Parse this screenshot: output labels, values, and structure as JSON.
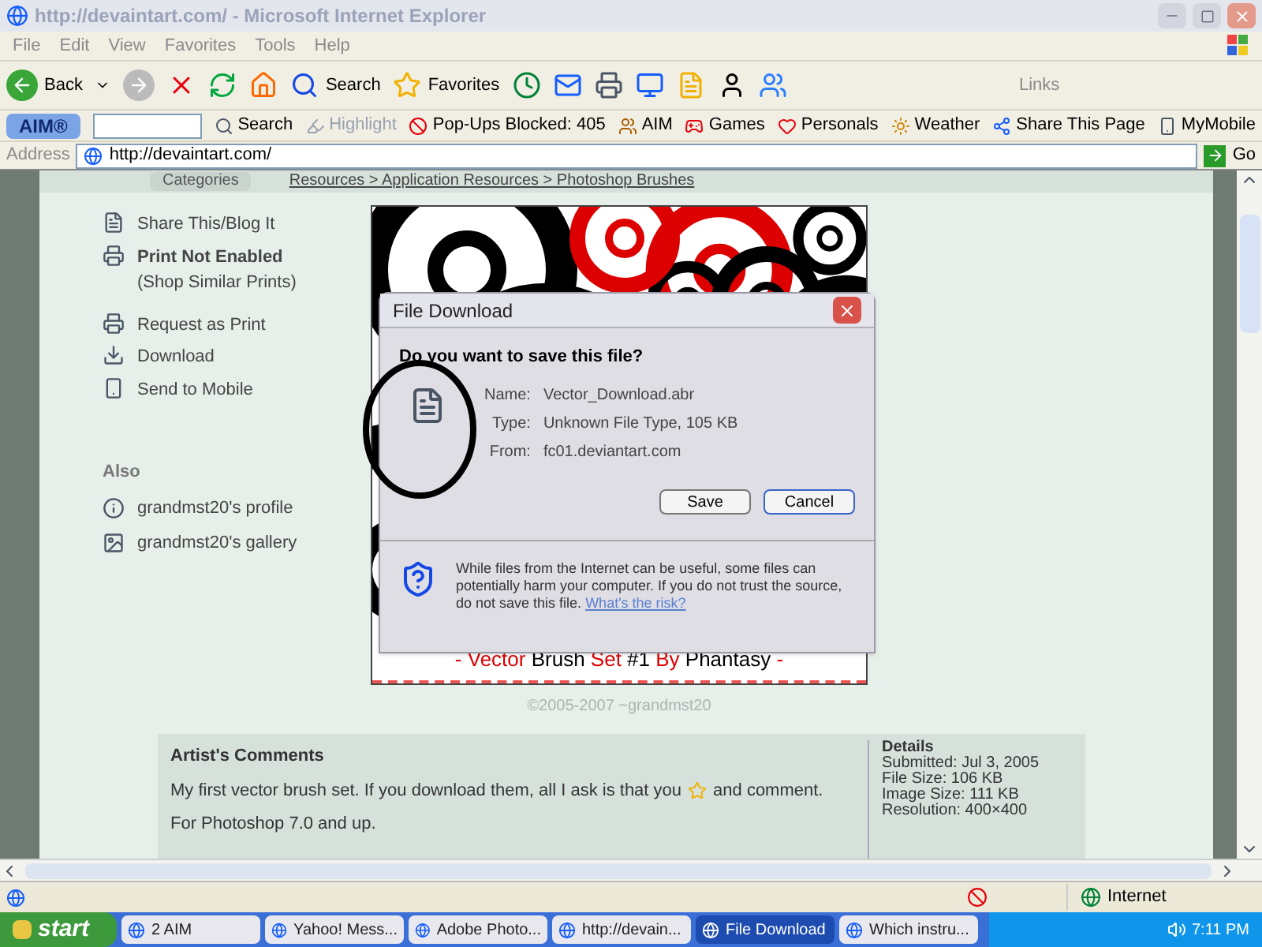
{
  "window": {
    "title": "http://devaintart.com/ - Microsoft Internet Explorer"
  },
  "menu": [
    "File",
    "Edit",
    "View",
    "Favorites",
    "Tools",
    "Help"
  ],
  "toolbar": {
    "back": "Back",
    "search": "Search",
    "favorites": "Favorites",
    "links": "Links"
  },
  "aim_toolbar": {
    "brand": "AIM®",
    "items": [
      {
        "label": "Search",
        "disabled": false
      },
      {
        "label": "Highlight",
        "disabled": true
      },
      {
        "label": "Pop-Ups Blocked: 405",
        "disabled": false
      },
      {
        "label": "AIM",
        "disabled": false
      },
      {
        "label": "Games",
        "disabled": false
      },
      {
        "label": "Personals",
        "disabled": false
      },
      {
        "label": "Weather",
        "disabled": false
      },
      {
        "label": "Share This Page",
        "disabled": false
      },
      {
        "label": "MyMobile",
        "disabled": false
      }
    ]
  },
  "address_bar": {
    "label": "Address",
    "value": "http://devaintart.com/",
    "go": "Go"
  },
  "page": {
    "categories": "Categories",
    "breadcrumb": "Resources > Application Resources > Photoshop Brushes",
    "actions": [
      {
        "label": "Share This/Blog It"
      },
      {
        "label": "Print Not Enabled",
        "note": "(Shop Similar Prints)"
      },
      {
        "label": "Request as Print"
      },
      {
        "label": "Download"
      },
      {
        "label": "Send to Mobile"
      }
    ],
    "also_heading": "Also",
    "also": [
      "grandmst20's profile",
      "grandmst20's gallery"
    ],
    "caption": [
      {
        "text": "- ",
        "highlighted": true
      },
      {
        "text": "Vector",
        "highlighted": true
      },
      {
        "text": " Brush ",
        "highlighted": false
      },
      {
        "text": "Set",
        "highlighted": true
      },
      {
        "text": " #1 ",
        "highlighted": false
      },
      {
        "text": "By",
        "highlighted": true
      },
      {
        "text": " Phantasy ",
        "highlighted": false
      },
      {
        "text": "-",
        "highlighted": true
      }
    ],
    "copyright": "©2005-2007 ~grandmst20",
    "comments": {
      "heading": "Artist's Comments",
      "before_icon": "My first vector brush set. If you download them, all I ask is that you",
      "after_icon": "and comment.",
      "second": "For Photoshop 7.0 and up."
    },
    "details": {
      "heading": "Details",
      "lines": [
        "Submitted: Jul 3, 2005",
        "File Size: 106 KB",
        "Image Size: 111 KB",
        "Resolution: 400×400"
      ]
    }
  },
  "dialog": {
    "title": "File Download",
    "question": "Do you want to save this file?",
    "fields": [
      {
        "label": "Name:",
        "value": "Vector_Download.abr"
      },
      {
        "label": "Type:",
        "value": "Unknown File Type, 105 KB"
      },
      {
        "label": "From:",
        "value": "fc01.deviantart.com"
      }
    ],
    "buttons": [
      "Save",
      "Cancel"
    ],
    "warning": "While files from the Internet can be useful, some files can potentially harm your computer. If you do not trust the source, do not save this file.",
    "risk_link": "What's the risk?"
  },
  "status_bar": {
    "zone": "Internet"
  },
  "taskbar": {
    "start": "start",
    "tasks": [
      {
        "label": "2 AIM",
        "selected": false
      },
      {
        "label": "Yahoo! Mess...",
        "selected": false
      },
      {
        "label": "Adobe Photo...",
        "selected": false
      },
      {
        "label": "http://devain...",
        "selected": false
      },
      {
        "label": "File Download",
        "selected": true
      },
      {
        "label": "Which instru...",
        "selected": false
      }
    ],
    "clock": "7:11 PM"
  }
}
